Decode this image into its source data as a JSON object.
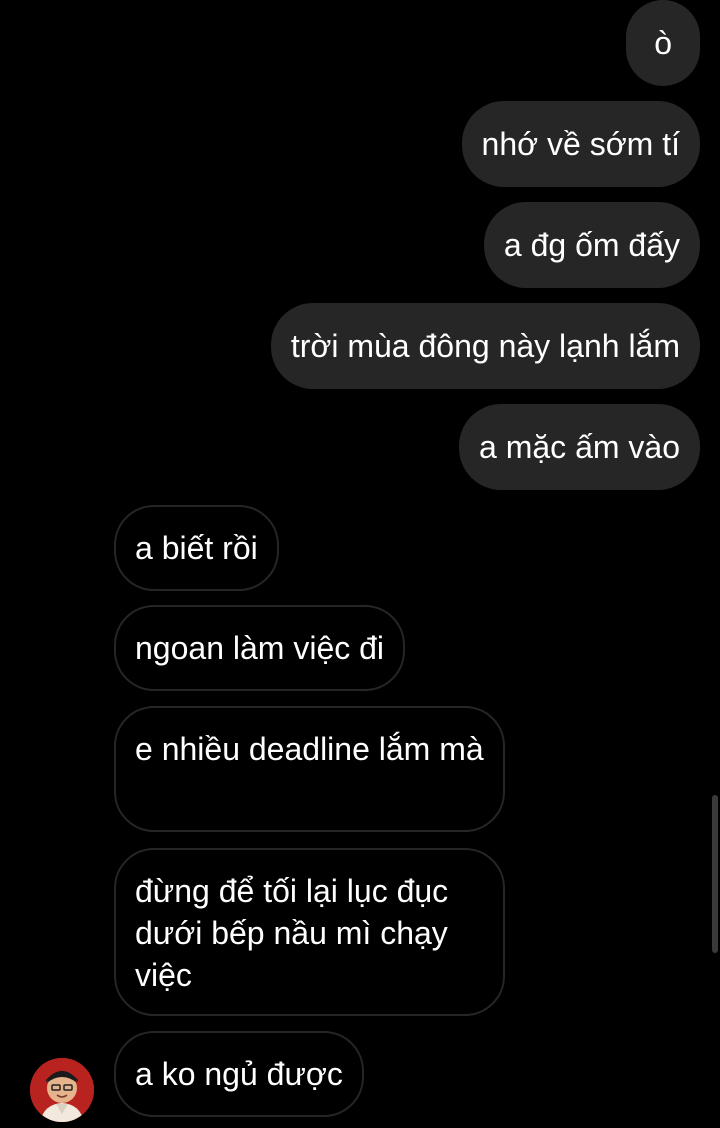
{
  "colors": {
    "background": "#000000",
    "sent_bubble": "#262626",
    "received_border": "#262626",
    "text": "#ffffff"
  },
  "messages": {
    "sent": [
      {
        "text": "ò"
      },
      {
        "text": "nhớ về sớm tí"
      },
      {
        "text": "a đg ốm đấy"
      },
      {
        "text": "trời mùa đông này lạnh lắm"
      },
      {
        "text": "a mặc ấm vào"
      }
    ],
    "received": [
      {
        "text": "a biết rồi"
      },
      {
        "text": "ngoan làm việc đi"
      },
      {
        "text": "e nhiều deadline lắm mà"
      },
      {
        "text": "đừng để tối lại lục đục dưới bếp nầu mì chạy việc"
      },
      {
        "text": "a ko ngủ được"
      }
    ]
  },
  "contact": {
    "avatar_icon": "user-avatar"
  }
}
